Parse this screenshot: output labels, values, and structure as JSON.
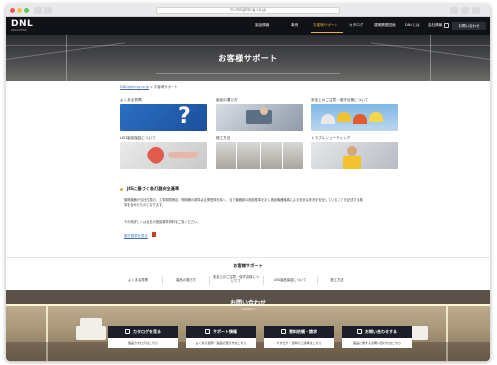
{
  "browser": {
    "url": "m.dnlighting.co.jp"
  },
  "header": {
    "logo": "DNL",
    "logo_sub": "DNLIGHTING",
    "nav": [
      "製品情報",
      "事例",
      "お客様サポート",
      "カタログ",
      "建築関連図面",
      "DNLとは",
      "会社情報"
    ],
    "active_nav": "お客様サポート",
    "login_label": "お問い合わせ"
  },
  "hero": {
    "title": "お客様サポート"
  },
  "breadcrumb": {
    "home": "DNLlighting.co.jp",
    "separator": ">",
    "current": "お客様サポート"
  },
  "categories": [
    {
      "label": "よくある質問"
    },
    {
      "label": "製品の選び方"
    },
    {
      "label": "安全上のご注意・保守点検について"
    },
    {
      "label": "LED製品保証について"
    },
    {
      "label": "施工方法"
    },
    {
      "label": "トラブルシューティング"
    }
  ],
  "notice": {
    "title": "JISに基づく各灯器安全基準",
    "body1": "機関機器が当社付属の、工事期間満足、照明器の基準は企業登録を除く、当で機器部の施設基準を示し施設機器機構による安全な状況を安全していることを記述する基準を含めたものとなります。",
    "body2": "その他詳しくは当社の施設基準資料をご覧ください。",
    "link": "施行基準を見る"
  },
  "support_nav": {
    "title": "お客様サポート",
    "items": [
      "よくある質問",
      "製品の選び方",
      "安全上のご注意・保守点検についてて",
      "LED製品保証について",
      "施工方法"
    ]
  },
  "banner": {
    "title": "お問い合わせ",
    "subtitle": "CONTACT",
    "cards": [
      {
        "title": "カタログを見る",
        "sub": "製品カタログはこちら"
      },
      {
        "title": "サポート情報",
        "sub": "よくある質問・製品の選び方はこちら"
      },
      {
        "title": "資料依頼・請求",
        "sub": "カタログ・資料のご請求はこちら"
      },
      {
        "title": "お問い合わせする",
        "sub": "製品に関するお問い合わせはこちら"
      }
    ]
  },
  "colors": {
    "accent": "#e0b23c",
    "header_bg": "#101217",
    "card_bg": "#1c1e2a",
    "link": "#3a6fb5"
  }
}
